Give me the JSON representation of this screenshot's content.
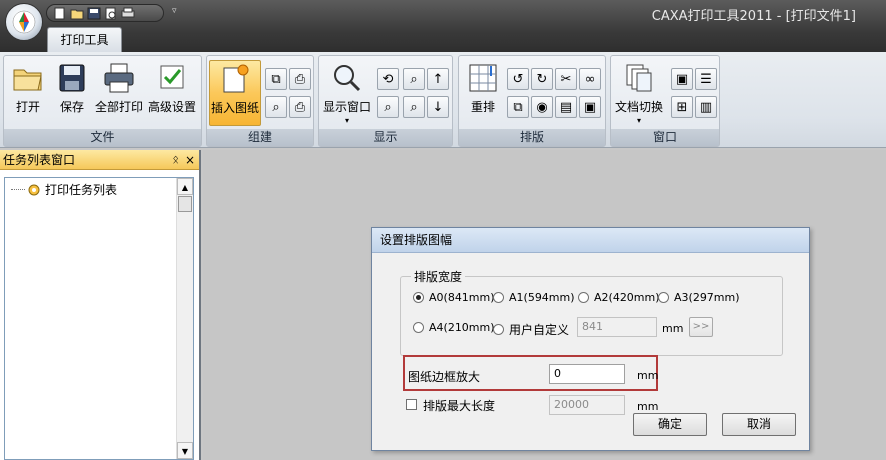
{
  "window": {
    "title": "CAXA打印工具2011 - [打印文件1]"
  },
  "ribbon": {
    "tab_label": "打印工具",
    "groups": {
      "file": {
        "label": "文件",
        "open": "打开",
        "save": "保存",
        "print_all": "全部打印",
        "advanced": "高级设置"
      },
      "build": {
        "label": "组建",
        "insert_sheet": "插入图纸"
      },
      "display": {
        "label": "显示",
        "display_window": "显示窗口"
      },
      "layout": {
        "label": "排版",
        "rearrange": "重排"
      },
      "window": {
        "label": "窗口",
        "doc_switch": "文档切换"
      }
    }
  },
  "task_panel": {
    "title": "任务列表窗口",
    "pin": "ᛟ",
    "close": "×",
    "tree_item": "打印任务列表"
  },
  "dialog": {
    "title": "设置排版图幅",
    "group_label": "排版宽度",
    "options": [
      {
        "label": "A0(841mm)",
        "selected": true
      },
      {
        "label": "A1(594mm)",
        "selected": false
      },
      {
        "label": "A2(420mm)",
        "selected": false
      },
      {
        "label": "A3(297mm)",
        "selected": false
      },
      {
        "label": "A4(210mm)",
        "selected": false
      },
      {
        "label": "用户自定义",
        "selected": false
      }
    ],
    "custom_width_value": "841",
    "unit": "mm",
    "more_button": ">>",
    "border_scale_label": "图纸边框放大",
    "border_scale_value": "0",
    "max_length_label": "排版最大长度",
    "max_length_value": "20000",
    "max_length_checked": false,
    "ok": "确定",
    "cancel": "取消"
  },
  "colors": {
    "highlight": "#b23a3a",
    "active_button": "#fbc85a"
  }
}
